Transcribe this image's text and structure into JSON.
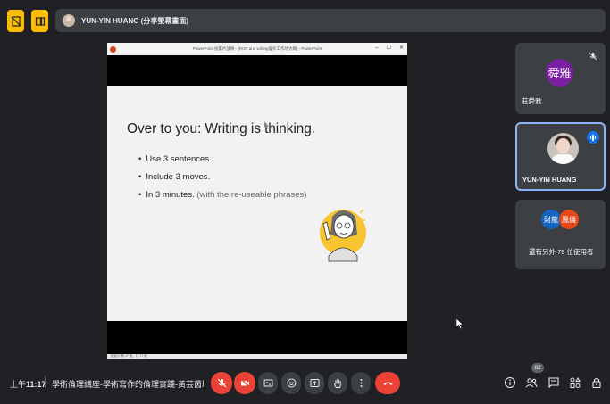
{
  "presenter_bar": {
    "name": "YUN-YIN HUANG (分享螢幕畫面)"
  },
  "shared_window": {
    "title": "PowerPoint 投影片放映 - [RCR and writing會外工作坊大綱] - PowerPoint",
    "status": "投影片 第 17 張，共 17 張"
  },
  "slide": {
    "title": "Over to you: Writing is thinking.",
    "bullets": [
      {
        "text": "Use 3 sentences.",
        "note": ""
      },
      {
        "text": "Include 3 moves.",
        "note": ""
      },
      {
        "text": "In 3 minutes. ",
        "note": "(with the re-useable phrases)"
      }
    ]
  },
  "participants": [
    {
      "initials": "舜雅",
      "name": "莊舜雅",
      "muted": true,
      "avatar_color": "#7b1fa2"
    },
    {
      "name": "YUN-YIN HUANG",
      "speaking": true
    },
    {
      "avatar_a": "財龍",
      "avatar_b": "鳳儀",
      "name": "還有另外 79 位使用者"
    }
  ],
  "bottom_bar": {
    "time_prefix": "上午",
    "time": "11:17",
    "meeting_title": "學術倫理講座-學術寫作的倫理實踐-黃芸茵助...",
    "participant_count": "82"
  },
  "colors": {
    "background": "#202124",
    "tile": "#3c4043",
    "accent_yellow": "#fbbc04",
    "end_call_red": "#ea4335",
    "speaking_blue": "#1a73e8"
  },
  "icons": [
    "stop-present-icon",
    "split-screen-icon",
    "mic-off-icon",
    "camera-off-icon",
    "captions-icon",
    "emoji-icon",
    "present-icon",
    "raise-hand-icon",
    "more-options-icon",
    "end-call-icon",
    "info-icon",
    "people-icon",
    "chat-icon",
    "activities-icon",
    "host-controls-icon"
  ]
}
